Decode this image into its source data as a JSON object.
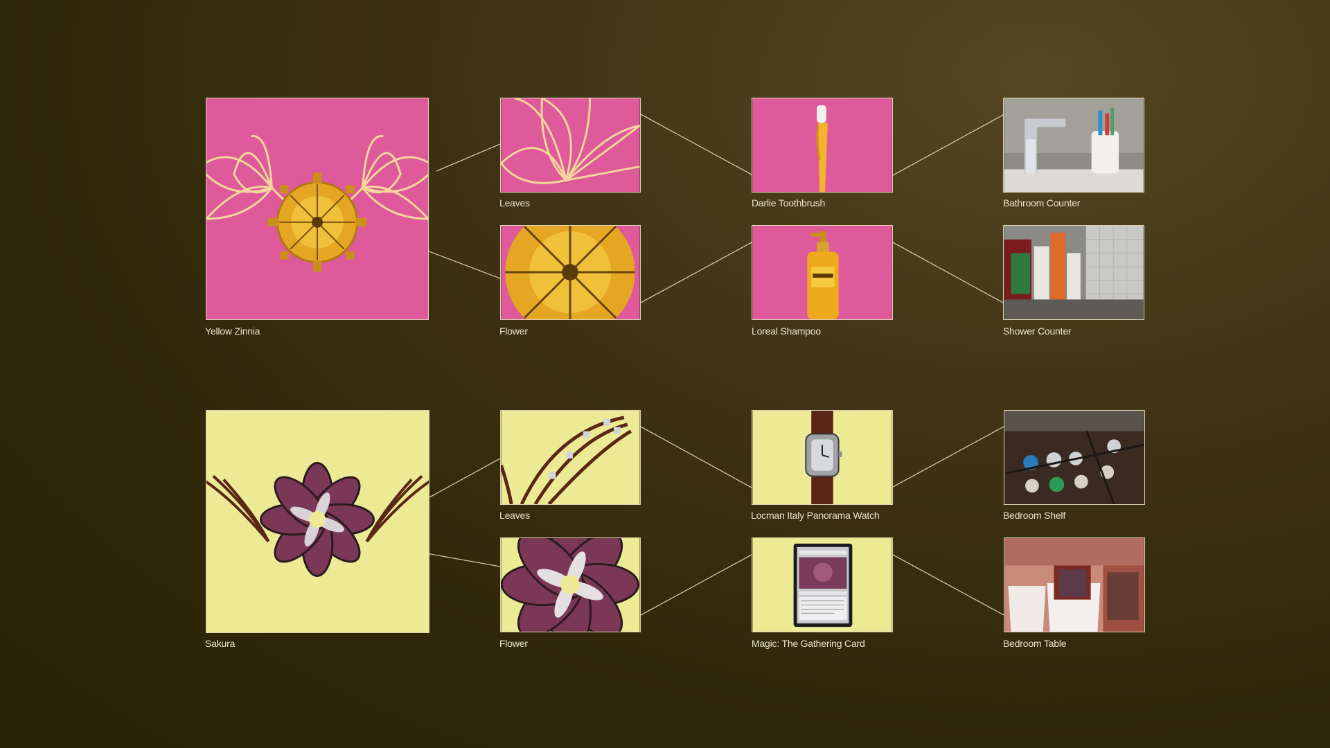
{
  "palette": {
    "background": "#3a3011",
    "pink": "#df5a9a",
    "yellow": "#ecea95",
    "connector": "#e6dcb8",
    "caption": "#ece5cf"
  },
  "rows": [
    {
      "source": {
        "label": "Yellow Zinnia",
        "icon": "yellow-zinnia-collage"
      },
      "parts": [
        {
          "label": "Leaves",
          "icon": "leaves-crop"
        },
        {
          "label": "Flower",
          "icon": "flower-crop"
        }
      ],
      "objects": [
        {
          "label": "Darlie Toothbrush",
          "icon": "toothbrush-photo"
        },
        {
          "label": "Loreal Shampoo",
          "icon": "shampoo-bottle-photo"
        }
      ],
      "places": [
        {
          "label": "Bathroom Counter",
          "icon": "bathroom-counter-photo"
        },
        {
          "label": "Shower Counter",
          "icon": "shower-counter-photo"
        }
      ]
    },
    {
      "source": {
        "label": "Sakura",
        "icon": "sakura-collage"
      },
      "parts": [
        {
          "label": "Leaves",
          "icon": "leaves-crop"
        },
        {
          "label": "Flower",
          "icon": "flower-crop"
        }
      ],
      "objects": [
        {
          "label": "Locman Italy Panorama Watch",
          "icon": "watch-photo"
        },
        {
          "label": "Magic: The Gathering Card",
          "icon": "trading-card-photo"
        }
      ],
      "places": [
        {
          "label": "Bedroom Shelf",
          "icon": "watch-box-photo"
        },
        {
          "label": "Bedroom Table",
          "icon": "card-boxes-photo"
        }
      ]
    }
  ]
}
